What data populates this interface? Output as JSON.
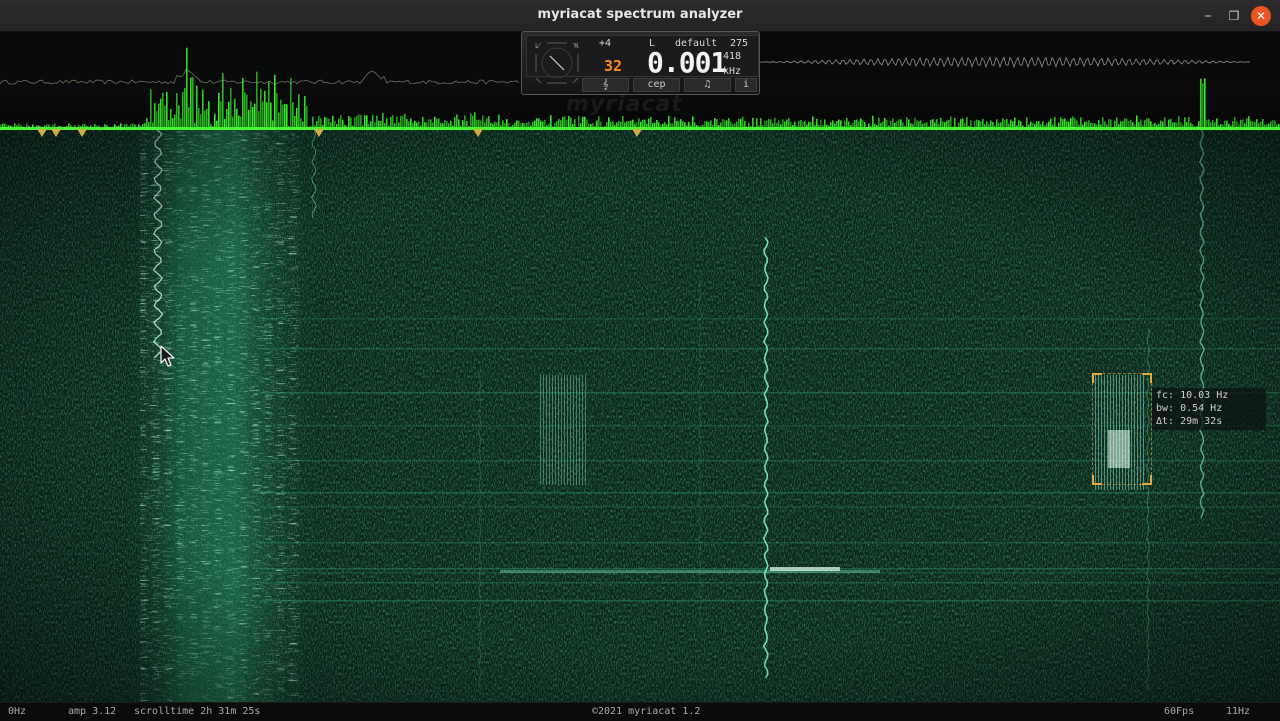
{
  "window": {
    "title": "myriacat spectrum analyzer",
    "controls": {
      "minimize": "–",
      "maximize": "❐",
      "close": "✕"
    },
    "accent": "#e95420"
  },
  "widget": {
    "offset": "+4",
    "channel": "L",
    "preset": "default",
    "counter": "275",
    "value_small": "32",
    "frequency": "0.001",
    "freq_side": "418",
    "unit": "kHz",
    "buttons": [
      "𝄞",
      "cep",
      "♫"
    ],
    "info": "i"
  },
  "watermark": "myriacat",
  "selection": {
    "fc": "fc: 10.03 Hz",
    "bw": "bw: 0.54 Hz",
    "dt": "Δt: 29m 32s"
  },
  "status": {
    "left_freq": "0Hz",
    "amp": "amp  3.12",
    "scrolltime": "scrolltime 2h 31m 25s",
    "copyright": "©2021 myriacat 1.2",
    "fps": "60Fps",
    "right_freq": "11Hz"
  },
  "colors": {
    "spectrum_green": "#3cff2a",
    "waterfall_base": "#0a2218",
    "marker": "#c9b042",
    "freq_orange": "#ff8a1a"
  },
  "icons": {
    "cursor": "arrow-pointer-icon",
    "scope": "stereo-scope-icon",
    "marker": "triangle-down-icon"
  }
}
